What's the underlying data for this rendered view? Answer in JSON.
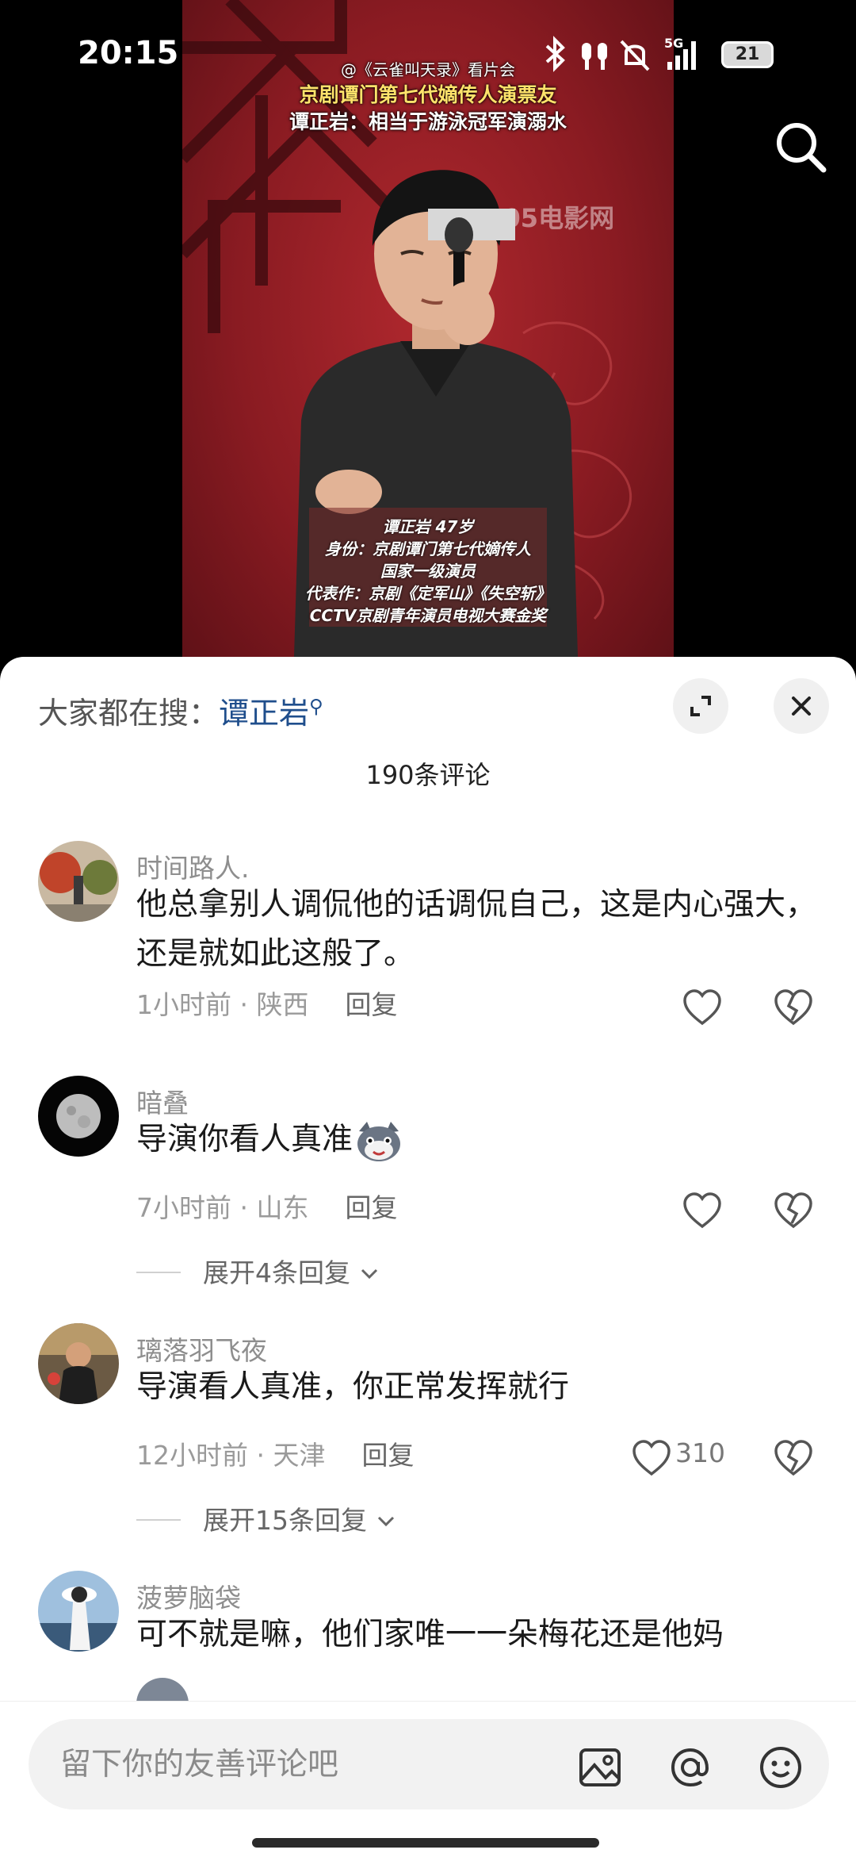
{
  "status_bar": {
    "time": "20:15",
    "battery": "21",
    "network": "5G"
  },
  "video": {
    "credit": "@《云雀叫天录》看片会",
    "title_line1": "京剧谭门第七代嫡传人演票友",
    "title_line2": "谭正岩：相当于游泳冠军演溺水",
    "watermark": "1905电影网",
    "info_lines": [
      "谭正岩 47岁",
      "身份：京剧谭门第七代嫡传人",
      "国家一级演员",
      "代表作：京剧《定军山》《失空斩》",
      "CCTV京剧青年演员电视大赛金奖"
    ]
  },
  "panel": {
    "hot_search_label": "大家都在搜：",
    "hot_search_keyword": "谭正岩",
    "comment_count": "190条评论"
  },
  "comments": [
    {
      "name": "时间路人.",
      "text": "他总拿别人调侃他的话调侃自己，这是内心强大，还是就如此这般了。",
      "meta": "1小时前 · 陕西",
      "reply": "回复",
      "likes": ""
    },
    {
      "name": "暗叠",
      "text": "导演你看人真准",
      "meta": "7小时前 · 山东",
      "reply": "回复",
      "likes": "",
      "expand": "展开4条回复"
    },
    {
      "name": "璃落羽飞夜",
      "text": "导演看人真准，你正常发挥就行",
      "meta": "12小时前 · 天津",
      "reply": "回复",
      "likes": "310",
      "expand": "展开15条回复"
    },
    {
      "name": "菠萝脑袋",
      "text": "可不就是嘛，他们家唯一一朵梅花还是他妈"
    }
  ],
  "input": {
    "placeholder": "留下你的友善评论吧"
  },
  "icons": {
    "search": "search-icon",
    "expand": "expand-icon",
    "close": "close-icon",
    "like": "heart-icon",
    "dislike": "broken-heart-icon",
    "image": "image-icon",
    "mention": "at-icon",
    "emoji": "emoji-icon"
  }
}
